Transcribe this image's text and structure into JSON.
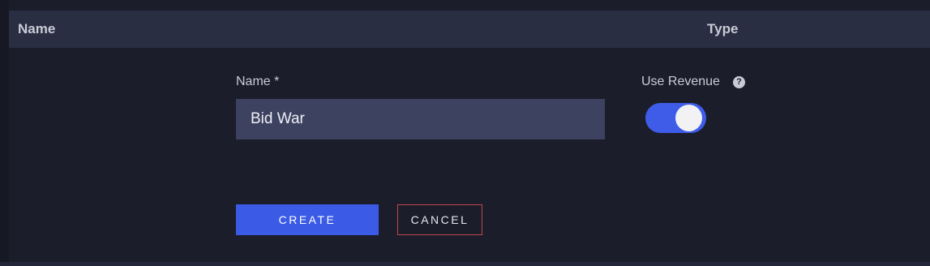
{
  "table_header": {
    "name_column": "Name",
    "type_column": "Type"
  },
  "form": {
    "name_label": "Name *",
    "name_value": "Bid War",
    "use_revenue_label": "Use Revenue",
    "use_revenue_enabled": true,
    "help_icon": "question-circle-icon",
    "create_label": "CREATE",
    "cancel_label": "CANCEL"
  },
  "colors": {
    "accent": "#3b5ae6",
    "cancel_border": "#c1454f",
    "background": "#1b1d2a",
    "header_background": "#2a2e43",
    "input_background": "#3d4260"
  }
}
